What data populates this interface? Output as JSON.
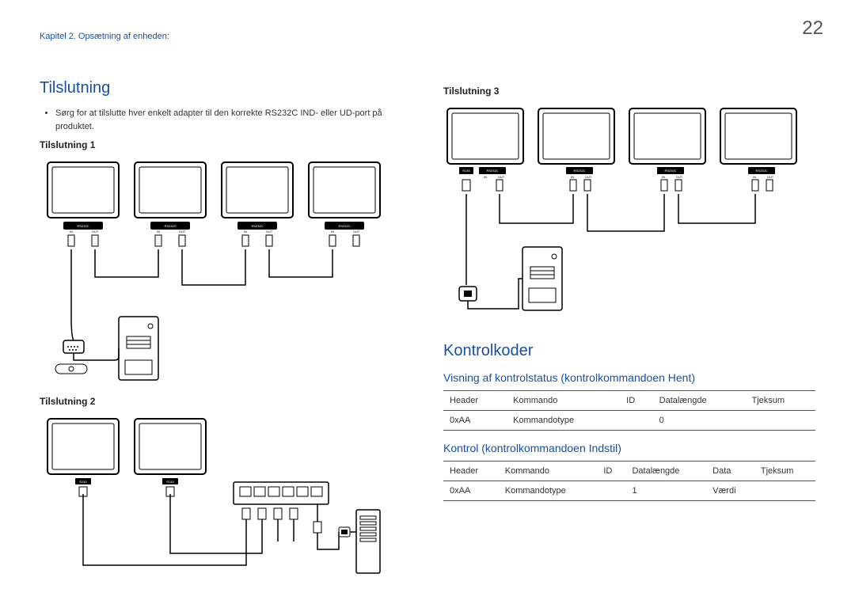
{
  "pageNumber": "22",
  "breadcrumb": "Kapitel 2. Opsætning af enheden:",
  "left": {
    "heading": "Tilslutning",
    "bullet": "Sørg for at tilslutte hver enkelt adapter til den korrekte RS232C IND- eller UD-port på produktet.",
    "sub1": "Tilslutning 1",
    "sub2": "Tilslutning 2"
  },
  "right": {
    "sub3": "Tilslutning 3",
    "heading2": "Kontrolkoder",
    "table1_title": "Visning af kontrolstatus (kontrolkommandoen Hent)",
    "table1": {
      "r1": {
        "c1": "Header",
        "c2": "Kommando",
        "c3": "ID",
        "c4": "Datalængde",
        "c5": "Tjeksum"
      },
      "r2": {
        "c1": "0xAA",
        "c2": "Kommandotype",
        "c3": "",
        "c4": "0",
        "c5": ""
      }
    },
    "table2_title": "Kontrol (kontrolkommandoen Indstil)",
    "table2": {
      "r1": {
        "c1": "Header",
        "c2": "Kommando",
        "c3": "ID",
        "c4": "Datalængde",
        "c5": "Data",
        "c6": "Tjeksum"
      },
      "r2": {
        "c1": "0xAA",
        "c2": "Kommandotype",
        "c3": "",
        "c4": "1",
        "c5": "Værdi",
        "c6": ""
      }
    }
  },
  "diagram_labels": {
    "rs232c": "RS232C",
    "in": "IN",
    "out": "OUT",
    "rj45": "RJ45"
  }
}
